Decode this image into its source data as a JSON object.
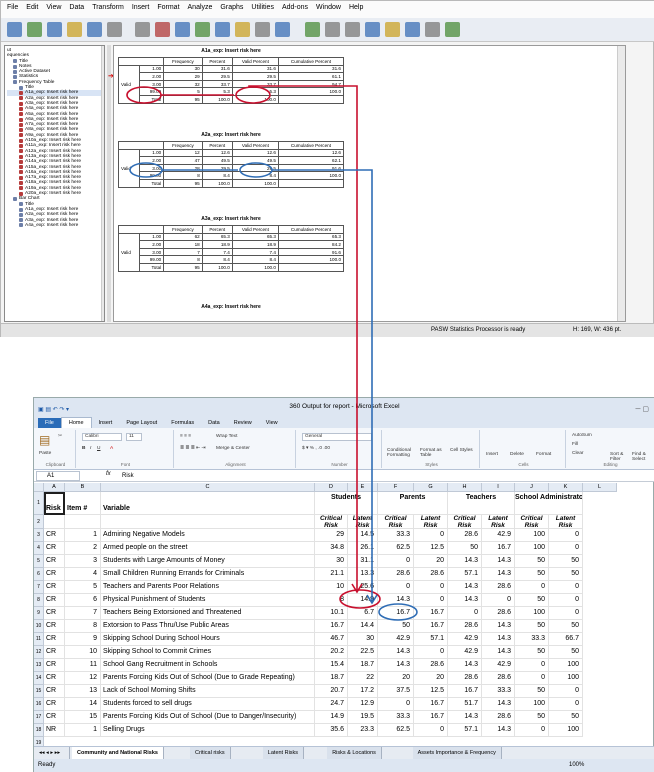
{
  "spss": {
    "menu": [
      "File",
      "Edit",
      "View",
      "Data",
      "Transform",
      "Insert",
      "Format",
      "Analyze",
      "Graphs",
      "Utilities",
      "Add-ons",
      "Window",
      "Help"
    ],
    "nav": [
      {
        "t": "ut",
        "i": ""
      },
      {
        "t": "equencies",
        "i": ""
      },
      {
        "t": "Title",
        "i": "i"
      },
      {
        "t": "Notes",
        "i": "i"
      },
      {
        "t": "Active Dataset",
        "i": "i"
      },
      {
        "t": "Statistics",
        "i": "i"
      },
      {
        "t": "Frequency Table",
        "i": "i"
      },
      {
        "t": "Title",
        "i": "i"
      },
      {
        "t": "A1a_exp: Insert risk here",
        "i": "s"
      },
      {
        "t": "A2a_exp: Insert risk here",
        "i": "s"
      },
      {
        "t": "A3a_exp: Insert risk here",
        "i": "s"
      },
      {
        "t": "A4a_exp: Insert risk here",
        "i": "s"
      },
      {
        "t": "A5a_exp: Insert risk here",
        "i": "s"
      },
      {
        "t": "A6a_exp: Insert risk here",
        "i": "s"
      },
      {
        "t": "A7a_exp: Insert risk here",
        "i": "s"
      },
      {
        "t": "A8a_exp: Insert risk here",
        "i": "s"
      },
      {
        "t": "A9a_exp: Insert risk here",
        "i": "s"
      },
      {
        "t": "A10a_exp: Insert risk here",
        "i": "s"
      },
      {
        "t": "A11a_exp: Insert risk here",
        "i": "s"
      },
      {
        "t": "A12a_exp: Insert risk here",
        "i": "s"
      },
      {
        "t": "A13a_exp: Insert risk here",
        "i": "s"
      },
      {
        "t": "A14a_exp: Insert risk here",
        "i": "s"
      },
      {
        "t": "A15a_exp: Insert risk here",
        "i": "s"
      },
      {
        "t": "A16a_exp: Insert risk here",
        "i": "s"
      },
      {
        "t": "A17a_exp: Insert risk here",
        "i": "s"
      },
      {
        "t": "A18a_exp: Insert risk here",
        "i": "s"
      },
      {
        "t": "A19a_exp: Insert risk here",
        "i": "s"
      },
      {
        "t": "A20a_exp: Insert risk here",
        "i": "s"
      },
      {
        "t": "Bar Chart",
        "i": "i"
      },
      {
        "t": "Title",
        "i": "i"
      },
      {
        "t": "A1a_exp: Insert risk here",
        "i": "i"
      },
      {
        "t": "A2a_exp: Insert risk here",
        "i": "i"
      },
      {
        "t": "A3a_exp: Insert risk here",
        "i": "i"
      },
      {
        "t": "A4a_exp: Insert risk here",
        "i": "i"
      }
    ],
    "tables": [
      {
        "title": "A1a_exp: Insert risk here",
        "headers": [
          "Frequency",
          "Percent",
          "Valid Percent",
          "Cumulative Percent"
        ],
        "valid_label": "Valid",
        "total_label": "Total",
        "rows": [
          [
            "1.00",
            "30",
            "31.6",
            "31.6",
            "31.6"
          ],
          [
            "2.00",
            "29",
            "29.5",
            "29.5",
            "61.1"
          ],
          [
            "3.00",
            "32",
            "33.7",
            "33.7",
            "94.7"
          ],
          [
            "99.00",
            "5",
            "5.3",
            "5.3",
            "100.0"
          ],
          [
            "Total",
            "95",
            "100.0",
            "100.0",
            ""
          ]
        ]
      },
      {
        "title": "A2a_exp: Insert risk here",
        "headers": [
          "Frequency",
          "Percent",
          "Valid Percent",
          "Cumulative Percent"
        ],
        "valid_label": "Valid",
        "total_label": "Total",
        "rows": [
          [
            "1.00",
            "12",
            "12.6",
            "12.6",
            "12.6"
          ],
          [
            "2.00",
            "47",
            "49.5",
            "49.5",
            "62.1"
          ],
          [
            "3.00",
            "28",
            "29.5",
            "29.5",
            "91.6"
          ],
          [
            "99.00",
            "8",
            "8.4",
            "8.4",
            "100.0"
          ],
          [
            "Total",
            "95",
            "100.0",
            "100.0",
            ""
          ]
        ]
      },
      {
        "title": "A3a_exp: Insert risk here",
        "headers": [
          "Frequency",
          "Percent",
          "Valid Percent",
          "Cumulative Percent"
        ],
        "valid_label": "Valid",
        "total_label": "Total",
        "rows": [
          [
            "1.00",
            "62",
            "65.3",
            "65.3",
            "65.3"
          ],
          [
            "2.00",
            "18",
            "18.9",
            "18.9",
            "84.2"
          ],
          [
            "3.00",
            "7",
            "7.4",
            "7.4",
            "91.6"
          ],
          [
            "99.00",
            "8",
            "8.4",
            "8.4",
            "100.0"
          ],
          [
            "Total",
            "95",
            "100.0",
            "100.0",
            ""
          ]
        ]
      },
      {
        "title": "A4a_exp: Insert risk here",
        "headers": [],
        "valid_label": "",
        "total_label": "",
        "rows": []
      }
    ],
    "status_processor": "PASW Statistics Processor is ready",
    "status_dims": "H: 169, W: 436 pt."
  },
  "excel": {
    "title": "360 Output for report - Microsoft Excel",
    "tabs": [
      "File",
      "Home",
      "Insert",
      "Page Layout",
      "Formulas",
      "Data",
      "Review",
      "View"
    ],
    "ribbon": {
      "paste": "Paste",
      "clipboard": "Clipboard",
      "font_name": "Calibri",
      "font_size": "11",
      "font": "Font",
      "wrap": "Wrap Text",
      "merge": "Merge & Center",
      "alignment": "Alignment",
      "numfmt": "General",
      "number": "Number",
      "cond": "Conditional Formatting",
      "fmt_table": "Format as Table",
      "cell_styles": "Cell Styles",
      "styles": "Styles",
      "insert": "Insert",
      "delete": "Delete",
      "format": "Format",
      "cells": "Cells",
      "autosum": "AutoSum",
      "fill": "Fill",
      "clear": "Clear",
      "sort": "Sort & Filter",
      "find": "Find & Select",
      "editing": "Editing"
    },
    "name_box": "A1",
    "fx": "fx",
    "formula": "Risk",
    "columns": [
      "A",
      "B",
      "C",
      "D",
      "E",
      "F",
      "G",
      "H",
      "I",
      "J",
      "K",
      "L"
    ],
    "header": {
      "risk": "Risk",
      "item": "Item #",
      "variable": "Variable",
      "groups": [
        "Students",
        "Parents",
        "Teachers",
        "School Administrator"
      ],
      "critical": "Critical Risk",
      "latent": "Latent Risk"
    },
    "rows": [
      [
        "CR",
        "1",
        "Admiring Negative Models",
        "29",
        "14.5",
        "33.3",
        "0",
        "28.6",
        "42.9",
        "100",
        "0"
      ],
      [
        "CR",
        "2",
        "Armed people on the street",
        "34.8",
        "26.1",
        "62.5",
        "12.5",
        "50",
        "16.7",
        "100",
        "0"
      ],
      [
        "CR",
        "3",
        "Students with Large Amounts of Money",
        "30",
        "31.1",
        "0",
        "20",
        "14.3",
        "14.3",
        "50",
        "50"
      ],
      [
        "CR",
        "4",
        "Small Children Running Errands for Criminals",
        "21.1",
        "13.3",
        "28.6",
        "28.6",
        "57.1",
        "14.3",
        "50",
        "50"
      ],
      [
        "CR",
        "5",
        "Teachers and Parents Poor Relations",
        "10",
        "25.6",
        "0",
        "0",
        "14.3",
        "28.6",
        "0",
        "0"
      ],
      [
        "CR",
        "6",
        "Physical Punishment of Students",
        "8",
        "14.9",
        "14.3",
        "0",
        "14.3",
        "0",
        "50",
        "0"
      ],
      [
        "CR",
        "7",
        "Teachers Being Extorsioned and Threatened",
        "10.1",
        "6.7",
        "16.7",
        "16.7",
        "0",
        "28.6",
        "100",
        "0"
      ],
      [
        "CR",
        "8",
        "Extorsion to Pass Thru/Use Public Areas",
        "16.7",
        "14.4",
        "50",
        "16.7",
        "28.6",
        "14.3",
        "50",
        "50"
      ],
      [
        "CR",
        "9",
        "Skipping School During School Hours",
        "46.7",
        "30",
        "42.9",
        "57.1",
        "42.9",
        "14.3",
        "33.3",
        "66.7"
      ],
      [
        "CR",
        "10",
        "Skipping School to Commit Crimes",
        "20.2",
        "22.5",
        "14.3",
        "0",
        "42.9",
        "14.3",
        "50",
        "50"
      ],
      [
        "CR",
        "11",
        "School Gang Recruitment in Schools",
        "15.4",
        "18.7",
        "14.3",
        "28.6",
        "14.3",
        "42.9",
        "0",
        "100"
      ],
      [
        "CR",
        "12",
        "Parents Forcing Kids Out of School (Due to Grade Repeating)",
        "18.7",
        "22",
        "20",
        "20",
        "28.6",
        "28.6",
        "0",
        "100"
      ],
      [
        "CR",
        "13",
        "Lack of School Morning Shifts",
        "20.7",
        "17.2",
        "37.5",
        "12.5",
        "16.7",
        "33.3",
        "50",
        "0"
      ],
      [
        "CR",
        "14",
        "Students forced to sell drugs",
        "24.7",
        "12.9",
        "0",
        "16.7",
        "51.7",
        "14.3",
        "100",
        "0"
      ],
      [
        "CR",
        "15",
        "Parents Forcing Kids Out of School (Due to Danger/Insecurity)",
        "14.9",
        "19.5",
        "33.3",
        "16.7",
        "14.3",
        "28.6",
        "50",
        "50"
      ],
      [
        "NR",
        "1",
        "Selling Drugs",
        "35.6",
        "23.3",
        "62.5",
        "0",
        "57.1",
        "14.3",
        "0",
        "100"
      ]
    ],
    "sheets": [
      "Community and National Risks",
      "Critical risks",
      "Latent Risks",
      "Risks & Locations",
      "Assets Importance & Frequency"
    ],
    "status": "Ready",
    "zoom": "100%"
  },
  "annotation_colors": {
    "red": "#c8102e",
    "blue": "#2f6db5"
  }
}
